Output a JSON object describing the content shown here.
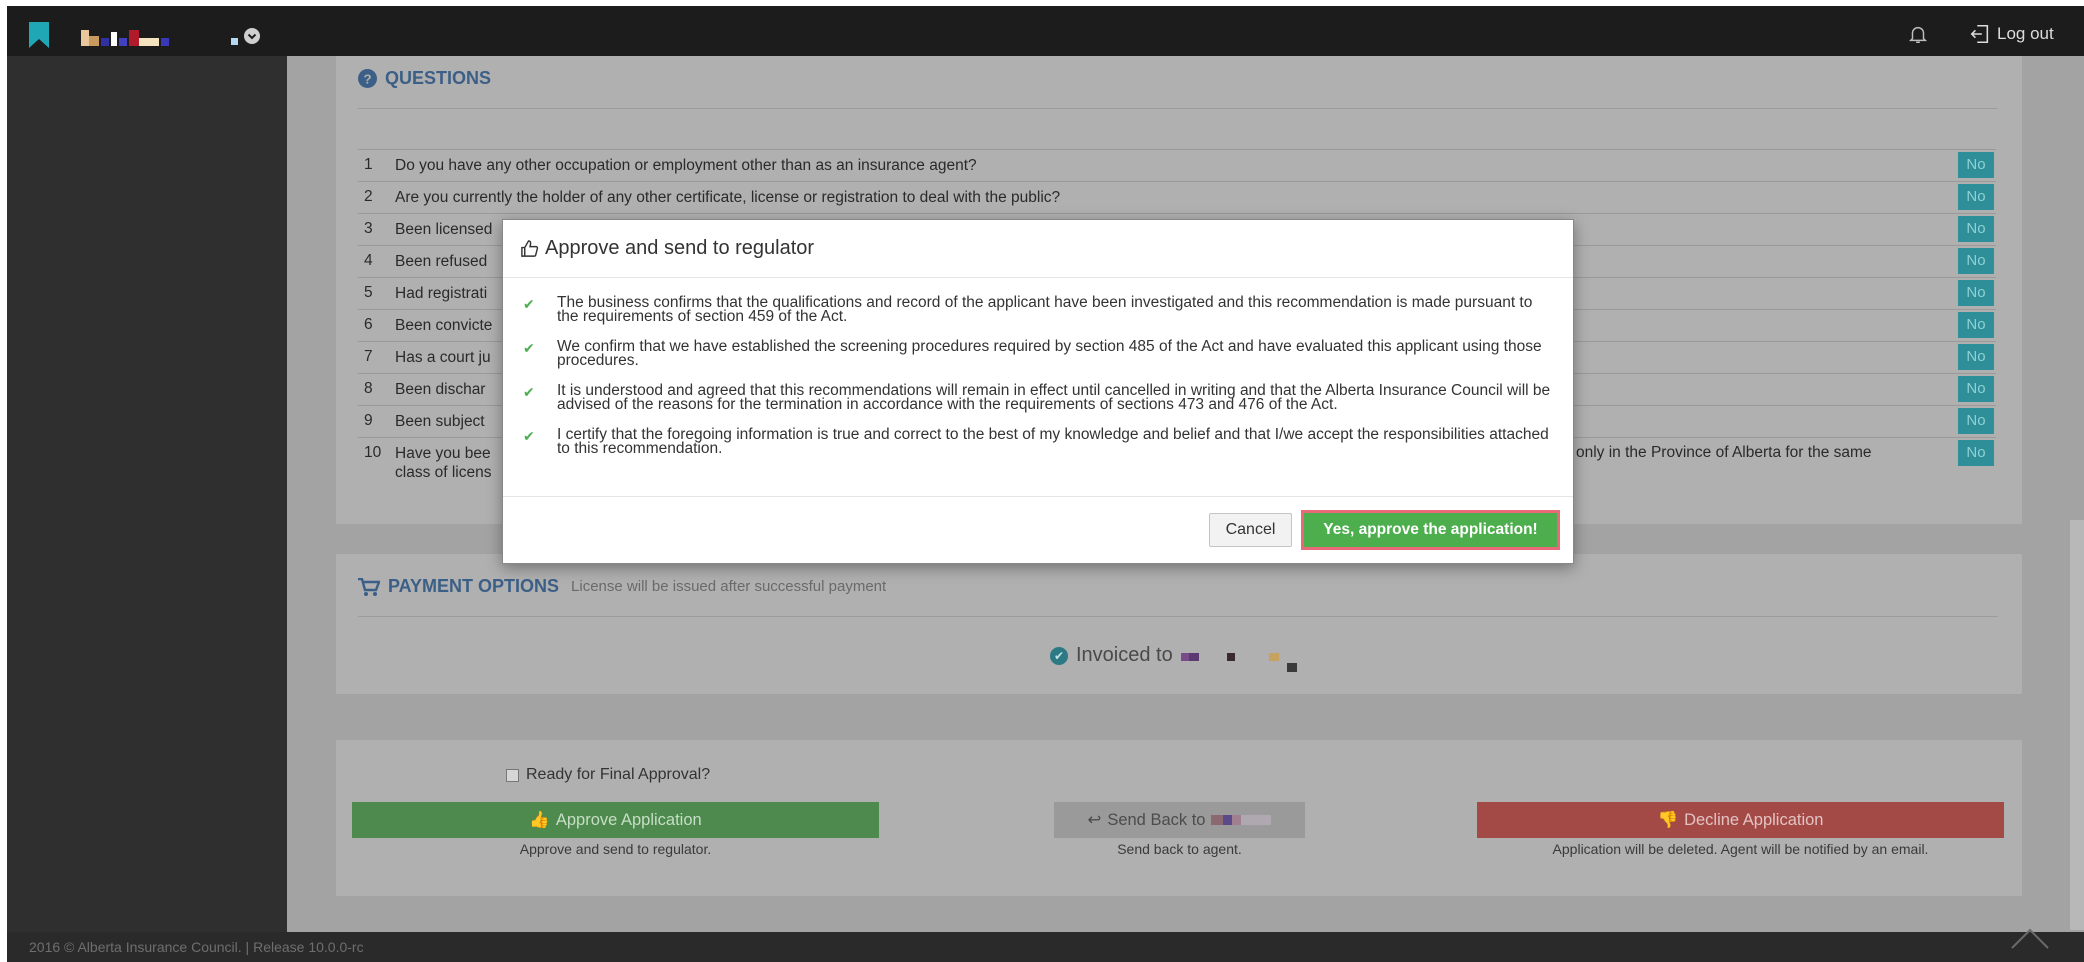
{
  "header": {
    "logout_label": "Log out"
  },
  "questions": {
    "title": "QUESTIONS",
    "items": [
      {
        "num": "1",
        "text": "Do you have any other occupation or employment other than as an insurance agent?",
        "answer": "No"
      },
      {
        "num": "2",
        "text": "Are you currently the holder of any other certificate, license or registration to deal with the public?",
        "answer": "No"
      },
      {
        "num": "3",
        "text": "Been licensed",
        "answer": "No"
      },
      {
        "num": "4",
        "text": "Been refused",
        "answer": "No"
      },
      {
        "num": "5",
        "text": "Had registrati",
        "answer": "No"
      },
      {
        "num": "6",
        "text": "Been convicte",
        "answer": "No"
      },
      {
        "num": "7",
        "text": "Has a court ju",
        "answer": "No"
      },
      {
        "num": "8",
        "text": "Been dischar",
        "answer": "No"
      },
      {
        "num": "9",
        "text": "Been subject",
        "answer": "No"
      },
      {
        "num": "10",
        "text": "Have you bee",
        "text_right": "only in the Province of Alberta for the same",
        "text_line2": "class of licens",
        "answer": "No"
      }
    ]
  },
  "payment": {
    "title": "PAYMENT OPTIONS",
    "subtitle": "License will be issued after successful payment",
    "invoiced_label": "Invoiced to"
  },
  "actions": {
    "ready_label": "Ready for Final Approval?",
    "approve_label": "Approve Application",
    "approve_note": "Approve and send to regulator.",
    "send_back_label": "Send Back to",
    "send_back_note": "Send back to agent.",
    "decline_label": "Decline Application",
    "decline_note": "Application will be deleted. Agent will be notified by an email."
  },
  "footer": {
    "text": "2016 © Alberta Insurance Council.  |  Release 10.0.0-rc"
  },
  "modal": {
    "title": "Approve and send to regulator",
    "items": [
      "The business confirms that the qualifications and record of the applicant have been investigated and this recommendation is made pursuant to the requirements of section 459 of the Act.",
      "We confirm that we have established the screening procedures required by section 485 of the Act and have evaluated this applicant using those procedures.",
      "It is understood and agreed that this recommendations will remain in effect until cancelled in writing and that the Alberta Insurance Council will be advised of the reasons for the termination in accordance with the requirements of sections 473 and 476 of the Act.",
      "I certify that the foregoing information is true and correct to the best of my knowledge and belief and that I/we accept the responsibilities attached to this recommendation."
    ],
    "cancel_label": "Cancel",
    "confirm_label": "Yes, approve the application!"
  },
  "colors": {
    "topbar": "#1c1c1c",
    "accent_teal": "#1fa7b5",
    "approve_green": "#5cb85c",
    "decline_red": "#d9534f",
    "highlight": "#e86a78"
  }
}
